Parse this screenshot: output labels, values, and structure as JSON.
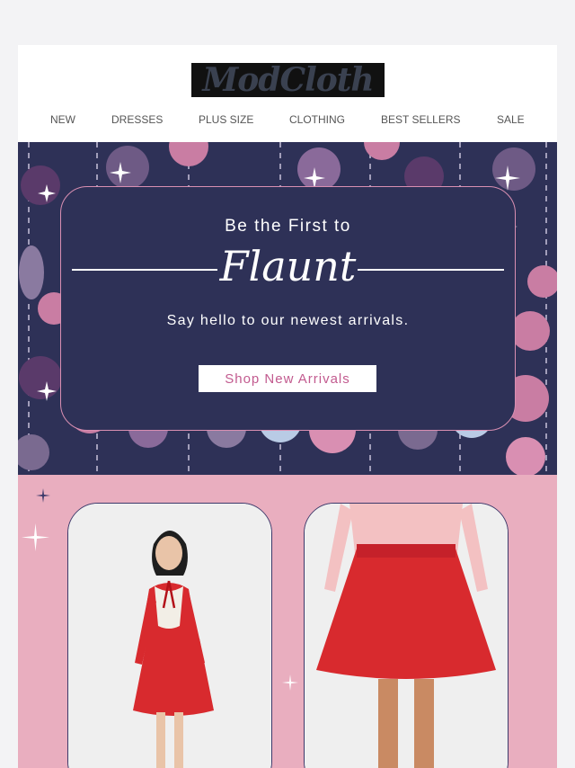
{
  "brand": {
    "logo_text": "ModCloth"
  },
  "nav": {
    "items": [
      "NEW",
      "DRESSES",
      "PLUS SIZE",
      "CLOTHING",
      "BEST SELLERS",
      "SALE"
    ]
  },
  "hero": {
    "pre_title": "Be the First to",
    "title": "Flaunt",
    "subtitle": "Say hello to our newest arrivals.",
    "cta_label": "Shop New Arrivals"
  },
  "colors": {
    "navy": "#2e3157",
    "pink_bg": "#e9aebf",
    "accent_pink": "#c25b8f",
    "dress_red": "#d82a2e"
  },
  "products": [
    {
      "icon": "red-dress-model-image"
    },
    {
      "icon": "red-skirt-model-image"
    }
  ]
}
